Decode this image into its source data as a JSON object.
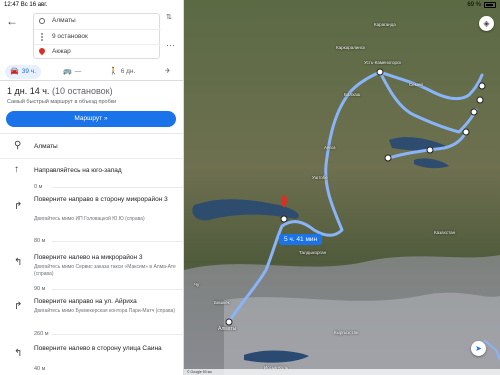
{
  "status_bar": {
    "time": "12:47",
    "date": "Вс 16 авг.",
    "battery": "69 %"
  },
  "route": {
    "origin": "Алматы",
    "via": "9 остановок",
    "destination": "Акжар",
    "swap_icon": "swap-arrows-icon",
    "more_icon": "more-dots-icon"
  },
  "modes": [
    {
      "icon": "car-icon",
      "label": "39 ч."
    },
    {
      "icon": "bus-icon",
      "label": "—"
    },
    {
      "icon": "walk-icon",
      "label": "6 дн."
    },
    {
      "icon": "plane-icon",
      "label": ""
    }
  ],
  "summary": {
    "duration": "1 дн. 14 ч.",
    "stops": "(10 остановок)",
    "subtitle": "Самый быстрый маршрут в объезд пробки",
    "button": "Маршрут"
  },
  "steps": [
    {
      "icon": "location-icon",
      "title": "Алматы",
      "desc": "",
      "distance": ""
    },
    {
      "icon": "arrow-up-icon",
      "title": "Направляйтесь на юго-запад",
      "desc": "",
      "distance": "0 м"
    },
    {
      "icon": "turn-right-icon",
      "title": "Поверните направо в сторону микрорайон 3",
      "desc": "Двигайтесь мимо ИП Головацкой Ю.Ю (справа)",
      "distance": "80 м"
    },
    {
      "icon": "turn-left-icon",
      "title": "Поверните налево на микрорайон 3",
      "desc": "Двигайтесь мимо Сервис заказа такси «Максим» в Алма-Ате (справа)",
      "distance": "90 м"
    },
    {
      "icon": "turn-right-icon",
      "title": "Поверните направо на ул. Айриха",
      "desc": "Двигайтесь мимо Букмекерская контора Пари-Матч (справа)",
      "distance": "260 м"
    },
    {
      "icon": "turn-left-icon",
      "title": "Поверните налево в сторону улица Саина",
      "desc": "",
      "distance": "40 м"
    }
  ],
  "map": {
    "eta_label": "5 ч. 41 мин",
    "labels": [
      "Караганда",
      "Каркаралинск",
      "Балхаш",
      "Усть-Каменогорск",
      "Семей",
      "Аягоз",
      "Уштобе",
      "Талдыкорган",
      "Бишкек",
      "Алматы",
      "Чу",
      "Кыргызстан",
      "Иссык-Куль",
      "Казахстан"
    ],
    "scale_text": "© Google  50 км",
    "route_color": "#8ab4f8",
    "marker_color": "#d93025"
  },
  "colors": {
    "accent": "#1a73e8",
    "route": "#8ab4f8"
  }
}
